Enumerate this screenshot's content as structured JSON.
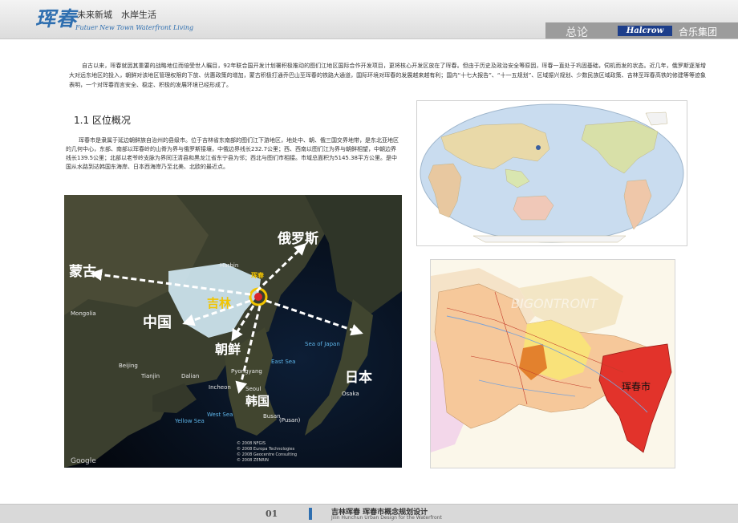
{
  "header": {
    "logo": "珲春",
    "slogan_cn": "未来新城　水岸生活",
    "slogan_en": "Futuer New Town  Waterfront Living",
    "section_title": "总论",
    "brand_logo": "Halcrow",
    "brand_name": "合乐集团"
  },
  "intro": "自古以来，珲春就因其重要的战略地位而倍受世人瞩目，92年联合国开发计划署积极推动的图们江地区国际合作开发项目，更将核心开发区放在了珲春。但由于历史及政治安全等原因，珲春一直处于巩固基础，伺机而发的状态。近几年，俄罗斯逐渐增大对远东地区的投入，朝鲜对该地区管理权限的下放、优惠政策的增加，蒙古积极打通乔巴山至珲春的铁路大通道，国际环境对珲春的发展越来越有利；国内“十七大报告”、“十一五规划”、区域振兴规划、少数民族区域政策、吉林至珲春高铁的修建等等迹象表明，一个对珲春而言安全、稳定、积极的发展环境已经形成了。",
  "section": {
    "heading": "1.1  区位概况",
    "body": "珲春市是隶属于延边朝鲜族自治州的县级市。位于吉林省东南部的图们江下游地区，地处中、朝、俄三国交界地带，是东北亚地区的几何中心，东部、南部以珲春岭的山脊为界与俄罗斯接壤，中俄边界线长232.7公里；西、西南以图们江为界与朝鲜相望，中朝边界线长139.5公里；北部以老爷岭支脉为界同汪清县和黑龙江省东宁县为邻；西北与图们市相接。市域总面积为5145.38平方公里。是中国从水路到达韩国东海岸、日本西海岸乃至北美、北欧的最近点。"
  },
  "satellite_map": {
    "labels_cn": {
      "russia": "俄罗斯",
      "mongolia": "蒙古",
      "china": "中国",
      "jilin": "吉林",
      "hunchun": "珲春",
      "dprk": "朝鲜",
      "korea": "韩国",
      "japan": "日本"
    },
    "labels_en": {
      "harbin": "Harbin",
      "mongolia": "Mongolia",
      "beijing": "Beijing",
      "tianjin": "Tianjin",
      "dalian": "Dalian",
      "pyongyang": "Pyongyang",
      "incheon": "Incheon",
      "seoul": "Seoul",
      "busan": "Busan",
      "pusan": "(Pusan)",
      "east_sea": "East Sea",
      "west_sea": "West Sea",
      "yellow_sea": "Yellow Sea",
      "sea_of_japan": "Sea of Japan",
      "osaka": "Osaka"
    },
    "credits": [
      "© 2008 NFGIS",
      "© 2008 Europa Technologies",
      "© 2008 Geocentre Consulting",
      "© 2008 ZENRIN"
    ],
    "google": "Google"
  },
  "region_map": {
    "city_label": "珲春市",
    "watermark": "BIGONTRONT"
  },
  "footer": {
    "page": "01",
    "title_cn": "吉林珲春  珲春市概念规划设计",
    "title_en": "Jilin Hunchun Urban Design for the Waterfront"
  }
}
